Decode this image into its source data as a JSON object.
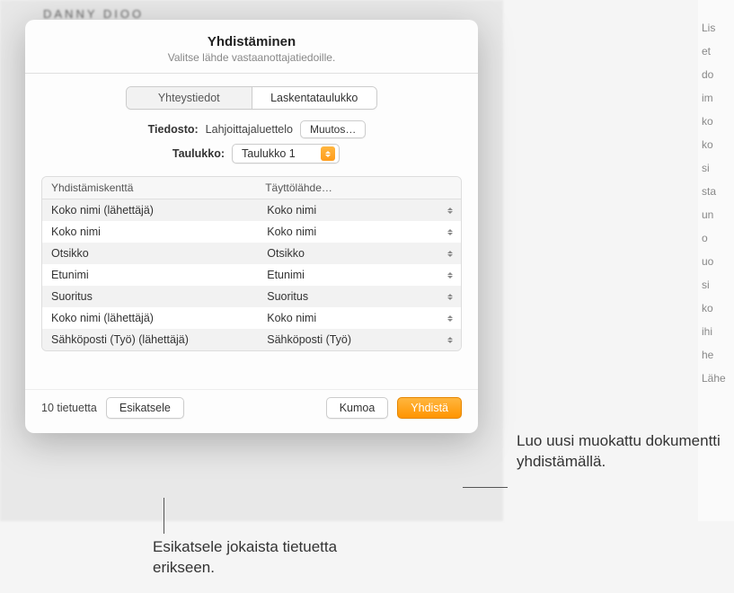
{
  "header": {
    "title": "Yhdistäminen",
    "subtitle": "Valitse lähde vastaanottajatiedoille."
  },
  "segmented": {
    "contacts": "Yhteystiedot",
    "spreadsheet": "Laskentataulukko"
  },
  "file_row": {
    "label": "Tiedosto:",
    "value": "Lahjoittajaluettelo",
    "change_btn": "Muutos…"
  },
  "table_row_sel": {
    "label": "Taulukko:",
    "value": "Taulukko 1"
  },
  "columns": {
    "merge_field": "Yhdistämiskenttä",
    "source": "Täyttölähde…"
  },
  "rows": [
    {
      "field": "Koko nimi (lähettäjä)",
      "source": "Koko nimi"
    },
    {
      "field": "Koko nimi",
      "source": "Koko nimi"
    },
    {
      "field": "Otsikko",
      "source": "Otsikko"
    },
    {
      "field": "Etunimi",
      "source": "Etunimi"
    },
    {
      "field": "Suoritus",
      "source": "Suoritus"
    },
    {
      "field": "Koko nimi (lähettäjä)",
      "source": "Koko nimi"
    },
    {
      "field": "Sähköposti (Työ) (lähettäjä)",
      "source": "Sähköposti (Työ)"
    }
  ],
  "footer": {
    "count": "10 tietuetta",
    "preview": "Esikatsele",
    "cancel": "Kumoa",
    "merge": "Yhdistä"
  },
  "callouts": {
    "merge": "Luo uusi muokattu dokumentti yhdistämällä.",
    "preview": "Esikatsele jokaista tietuetta erikseen."
  },
  "bg": {
    "partial_title": "DANNY DIOO",
    "strips": [
      "Lis",
      "et",
      "do",
      "im",
      "ko",
      "ko",
      "si",
      "sta",
      "un",
      "o",
      "uo",
      "si",
      "ko",
      "ihi",
      "he",
      "Lähe"
    ]
  }
}
